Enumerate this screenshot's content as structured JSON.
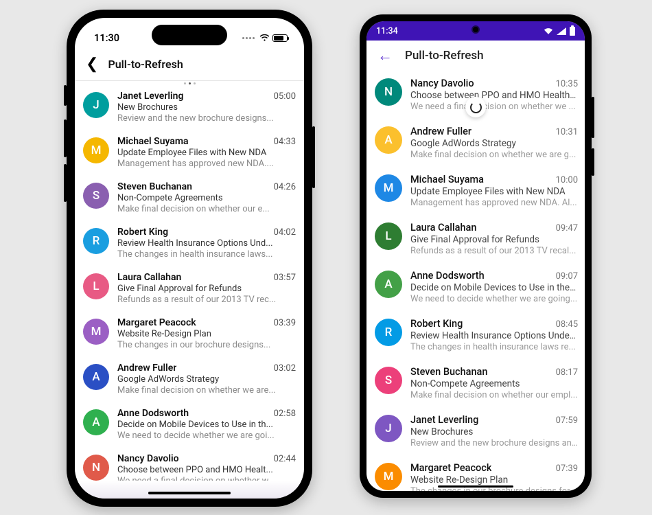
{
  "ios": {
    "status": {
      "time": "11:30"
    },
    "header": {
      "title": "Pull-to-Refresh"
    },
    "items": [
      {
        "initial": "J",
        "color": "c-teal",
        "sender": "Janet Leverling",
        "subject": "New Brochures",
        "preview": "Review and the new brochure designs...",
        "time": "05:00"
      },
      {
        "initial": "M",
        "color": "c-amber",
        "sender": "Michael Suyama",
        "subject": "Update Employee Files with New NDA",
        "preview": "Management has approved new NDA....",
        "time": "04:33"
      },
      {
        "initial": "S",
        "color": "c-purple",
        "sender": "Steven Buchanan",
        "subject": "Non-Compete Agreements",
        "preview": "Make final decision on whether our e...",
        "time": "04:26"
      },
      {
        "initial": "R",
        "color": "c-blue",
        "sender": "Robert King",
        "subject": "Review Health Insurance Options Und...",
        "preview": "The changes in health insurance laws...",
        "time": "04:02"
      },
      {
        "initial": "L",
        "color": "c-pink",
        "sender": "Laura Callahan",
        "subject": "Give Final Approval for Refunds",
        "preview": "Refunds as a result of our 2013 TV rec...",
        "time": "03:57"
      },
      {
        "initial": "M",
        "color": "c-violet",
        "sender": "Margaret Peacock",
        "subject": "Website Re-Design Plan",
        "preview": "The changes in our brochure designs...",
        "time": "03:39"
      },
      {
        "initial": "A",
        "color": "c-indigo",
        "sender": "Andrew Fuller",
        "subject": "Google AdWords Strategy",
        "preview": "Make final decision on whether we are...",
        "time": "03:02"
      },
      {
        "initial": "A",
        "color": "c-green",
        "sender": "Anne Dodsworth",
        "subject": "Decide on Mobile Devices to Use in th...",
        "preview": "We need to decide whether we are goi...",
        "time": "02:58"
      },
      {
        "initial": "N",
        "color": "c-red",
        "sender": "Nancy Davolio",
        "subject": "Choose between PPO and HMO Healt...",
        "preview": "We need a final decision on whether w...",
        "time": "02:44"
      }
    ]
  },
  "android": {
    "status": {
      "time": "11:34"
    },
    "header": {
      "title": "Pull-to-Refresh"
    },
    "items": [
      {
        "initial": "N",
        "color": "c-teal",
        "sender": "Nancy Davolio",
        "subject": "Choose between PPO and HMO Health ...",
        "preview": "We need a final decision on whether we ...",
        "time": "10:35"
      },
      {
        "initial": "A",
        "color": "c-amber",
        "sender": "Andrew Fuller",
        "subject": "Google AdWords Strategy",
        "preview": "Make final decision on whether we are g...",
        "time": "10:31"
      },
      {
        "initial": "M",
        "color": "c-blue",
        "sender": "Michael Suyama",
        "subject": "Update Employee Files with New NDA",
        "preview": "Management has approved new NDA. Al...",
        "time": "10:00"
      },
      {
        "initial": "L",
        "color": "c-green",
        "sender": "Laura Callahan",
        "subject": "Give Final Approval for Refunds",
        "preview": "Refunds as a result of our 2013 TV recal...",
        "time": "09:47"
      },
      {
        "initial": "A",
        "color": "c-green2",
        "sender": "Anne Dodsworth",
        "subject": "Decide on Mobile Devices to Use in the F...",
        "preview": "We need to decide whether we are going...",
        "time": "09:07"
      },
      {
        "initial": "R",
        "color": "c-blue2",
        "sender": "Robert King",
        "subject": "Review Health Insurance Options Under ...",
        "preview": "The changes in health insurance laws re...",
        "time": "08:45"
      },
      {
        "initial": "S",
        "color": "c-pink",
        "sender": "Steven Buchanan",
        "subject": "Non-Compete Agreements",
        "preview": "Make final decision on whether our empl...",
        "time": "08:17"
      },
      {
        "initial": "J",
        "color": "c-purple",
        "sender": "Janet Leverling",
        "subject": "New Brochures",
        "preview": "Review and the new brochure designs an...",
        "time": "07:59"
      },
      {
        "initial": "M",
        "color": "c-orange",
        "sender": "Margaret Peacock",
        "subject": "Website Re-Design Plan",
        "preview": "The changes in our brochure designs for...",
        "time": "07:39"
      }
    ]
  }
}
